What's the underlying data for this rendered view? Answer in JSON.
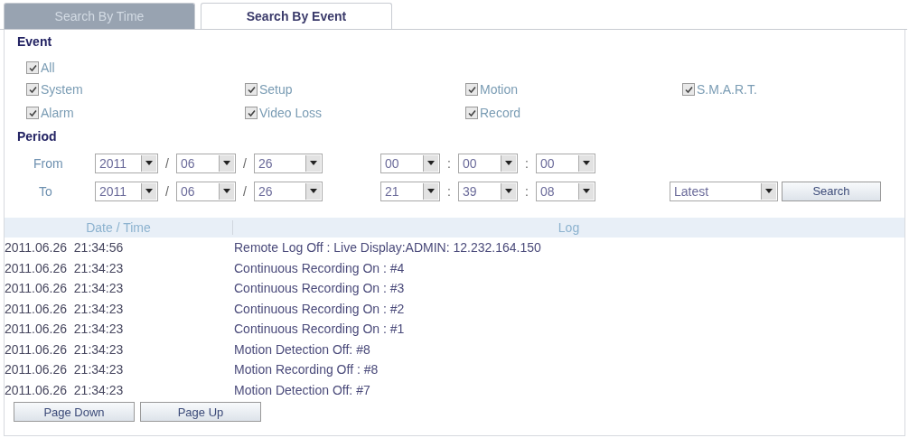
{
  "tabs": [
    {
      "label": "Search By Time",
      "selected": false
    },
    {
      "label": "Search By Event",
      "selected": true
    }
  ],
  "event": {
    "title": "Event",
    "all": {
      "label": "All",
      "checked": true
    },
    "options": [
      {
        "label": "System",
        "checked": true
      },
      {
        "label": "Setup",
        "checked": true
      },
      {
        "label": "Motion",
        "checked": true
      },
      {
        "label": "S.M.A.R.T.",
        "checked": true
      },
      {
        "label": "Alarm",
        "checked": true
      },
      {
        "label": "Video Loss",
        "checked": true
      },
      {
        "label": "Record",
        "checked": true
      }
    ]
  },
  "period": {
    "title": "Period",
    "rows": [
      {
        "label": "From",
        "parts": [
          {
            "kind": "select",
            "value": "2011"
          },
          {
            "kind": "sep",
            "text": "/"
          },
          {
            "kind": "select",
            "value": "06"
          },
          {
            "kind": "sep",
            "text": "/"
          },
          {
            "kind": "select",
            "value": "26"
          },
          {
            "kind": "gap"
          },
          {
            "kind": "select",
            "value": "00"
          },
          {
            "kind": "sep",
            "text": ":"
          },
          {
            "kind": "select",
            "value": "00"
          },
          {
            "kind": "sep",
            "text": ":"
          },
          {
            "kind": "select",
            "value": "00"
          }
        ]
      },
      {
        "label": "To",
        "parts": [
          {
            "kind": "select",
            "value": "2011"
          },
          {
            "kind": "sep",
            "text": "/"
          },
          {
            "kind": "select",
            "value": "06"
          },
          {
            "kind": "sep",
            "text": "/"
          },
          {
            "kind": "select",
            "value": "26"
          },
          {
            "kind": "gap"
          },
          {
            "kind": "select",
            "value": "21"
          },
          {
            "kind": "sep",
            "text": ":"
          },
          {
            "kind": "select",
            "value": "39"
          },
          {
            "kind": "sep",
            "text": ":"
          },
          {
            "kind": "select",
            "value": "08"
          }
        ]
      }
    ],
    "order": {
      "value": "Latest"
    },
    "search_button": "Search"
  },
  "table": {
    "columns": [
      "Date / Time",
      "Log"
    ],
    "rows": [
      [
        "2011.06.26  21:34:56",
        "Remote Log Off : Live Display:ADMIN: 12.232.164.150"
      ],
      [
        "2011.06.26  21:34:23",
        "Continuous Recording On : #4"
      ],
      [
        "2011.06.26  21:34:23",
        "Continuous Recording On : #3"
      ],
      [
        "2011.06.26  21:34:23",
        "Continuous Recording On : #2"
      ],
      [
        "2011.06.26  21:34:23",
        "Continuous Recording On : #1"
      ],
      [
        "2011.06.26  21:34:23",
        "Motion Detection Off: #8"
      ],
      [
        "2011.06.26  21:34:23",
        "Motion Recording Off : #8"
      ],
      [
        "2011.06.26  21:34:23",
        "Motion Detection Off: #7"
      ]
    ]
  },
  "buttons": [
    "Page Down",
    "Page Up"
  ]
}
